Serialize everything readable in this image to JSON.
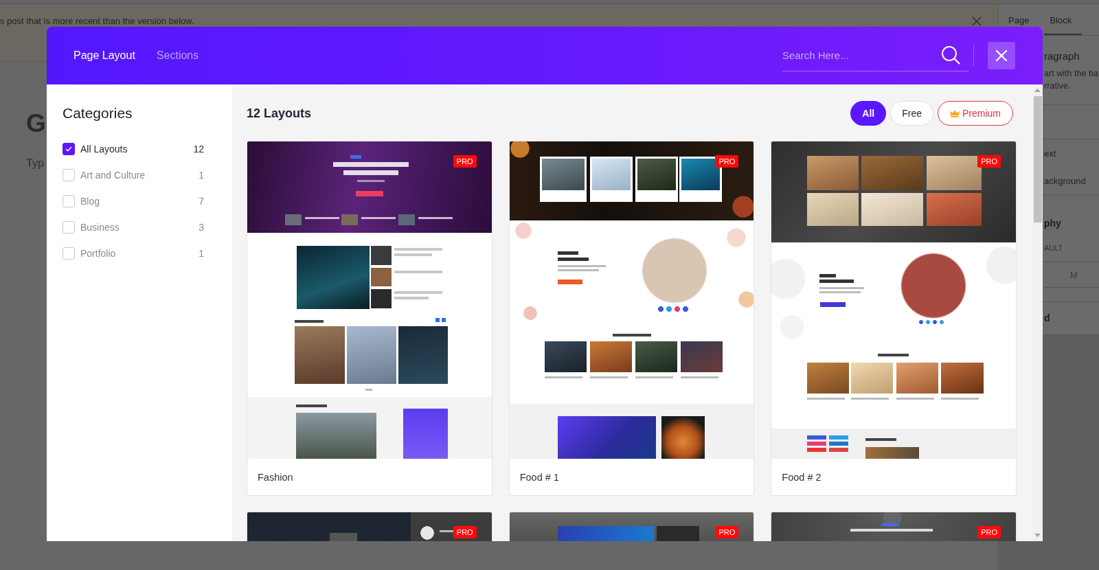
{
  "editor": {
    "notice": {
      "text": "s post that is more recent than the version below."
    },
    "title": "G",
    "body_block": {
      "placeholder": "Typ"
    },
    "settings_sidebar": {
      "tabs": [
        {
          "label": "Page",
          "selected": false
        },
        {
          "label": "Block",
          "selected": true
        }
      ],
      "block_card": {
        "title": "ragraph",
        "description": [
          "art with the ba",
          "rrative."
        ]
      },
      "color_options": [
        "ext",
        "ackground"
      ],
      "typography": {
        "title": "phy",
        "font_size_label": "AULT",
        "size_option": "M"
      },
      "advanced": {
        "title": "d"
      }
    }
  },
  "modal": {
    "tabs": [
      {
        "label": "Page Layout",
        "selected": true
      },
      {
        "label": "Sections",
        "selected": false
      }
    ],
    "search": {
      "placeholder": "Search Here..."
    },
    "categories": {
      "title": "Categories",
      "items": [
        {
          "label": "All Layouts",
          "count": "12",
          "checked": true
        },
        {
          "label": "Art and Culture",
          "count": "1",
          "checked": false
        },
        {
          "label": "Blog",
          "count": "7",
          "checked": false
        },
        {
          "label": "Business",
          "count": "3",
          "checked": false
        },
        {
          "label": "Portfolio",
          "count": "1",
          "checked": false
        }
      ]
    },
    "layouts": {
      "title": "12 Layouts",
      "filters": [
        {
          "label": "All",
          "selected": true,
          "kind": "plain"
        },
        {
          "label": "Free",
          "selected": false,
          "kind": "plain"
        },
        {
          "label": "Premium",
          "selected": false,
          "kind": "premium"
        }
      ],
      "items": [
        {
          "title": "Fashion",
          "badge": "PRO"
        },
        {
          "title": "Food # 1",
          "badge": "PRO"
        },
        {
          "title": "Food # 2",
          "badge": "PRO"
        },
        {
          "badge": "PRO"
        },
        {
          "badge": "PRO"
        },
        {
          "badge": "PRO"
        }
      ]
    }
  }
}
